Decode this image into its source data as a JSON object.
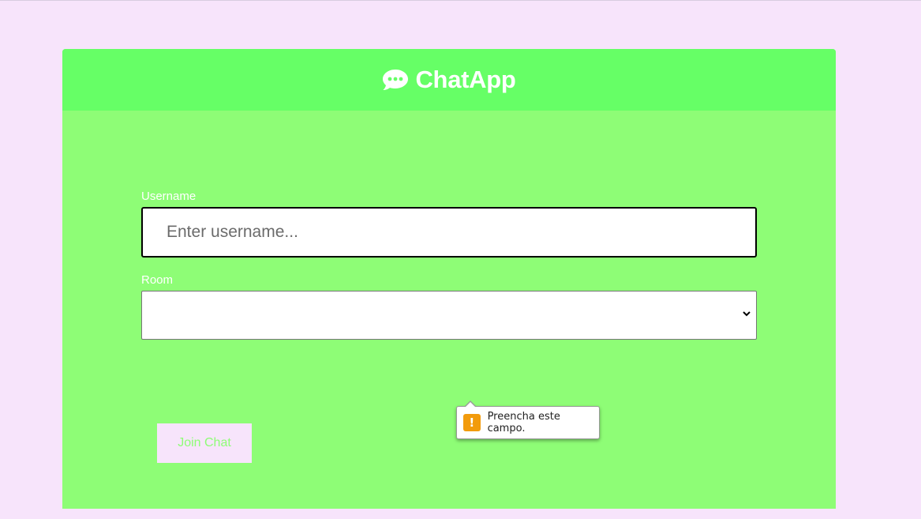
{
  "app": {
    "title": "ChatApp",
    "icon": "comment-dots-icon"
  },
  "form": {
    "username_label": "Username",
    "username_placeholder": "Enter username...",
    "username_value": "",
    "room_label": "Room",
    "room_selected": "",
    "join_label": "Join Chat"
  },
  "validation": {
    "message": "Preencha este campo.",
    "icon": "warning-icon"
  },
  "colors": {
    "page_background": "#f7e4fb",
    "header_background": "#66ff66",
    "card_background": "#8efd76",
    "text_white": "#ffffff",
    "warning": "#f29b0c"
  }
}
